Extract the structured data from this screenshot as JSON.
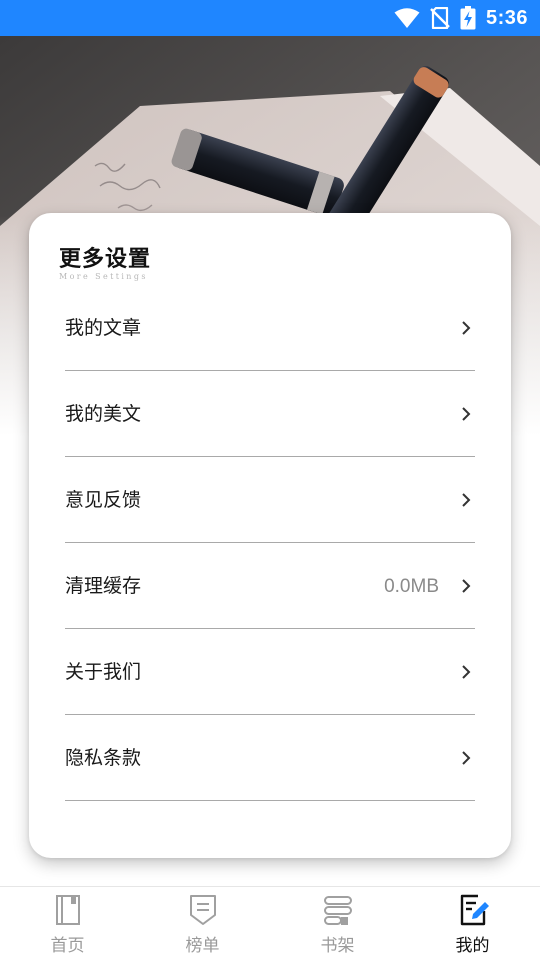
{
  "status_bar": {
    "time": "5:36",
    "icons": [
      "wifi-icon",
      "no-sim-icon",
      "battery-charging-icon"
    ],
    "background_color": "#1f86ff"
  },
  "hero": {
    "image": "pen-on-paper-photo"
  },
  "card": {
    "title": "更多设置",
    "subtitle": "More Settings",
    "items": [
      {
        "label": "我的文章",
        "value": "",
        "icon": "chevron-right-icon"
      },
      {
        "label": "我的美文",
        "value": "",
        "icon": "chevron-right-icon"
      },
      {
        "label": "意见反馈",
        "value": "",
        "icon": "chevron-right-icon"
      },
      {
        "label": "清理缓存",
        "value": "0.0MB",
        "icon": "chevron-right-icon"
      },
      {
        "label": "关于我们",
        "value": "",
        "icon": "chevron-right-icon"
      },
      {
        "label": "隐私条款",
        "value": "",
        "icon": "chevron-right-icon"
      }
    ]
  },
  "bottom_nav": {
    "items": [
      {
        "label": "首页",
        "icon": "book-icon",
        "active": false
      },
      {
        "label": "榜单",
        "icon": "ranking-badge-icon",
        "active": false
      },
      {
        "label": "书架",
        "icon": "bookshelf-icon",
        "active": false
      },
      {
        "label": "我的",
        "icon": "edit-document-icon",
        "active": true
      }
    ],
    "active_color": "#1f86ff",
    "inactive_color": "#9a9a9a"
  }
}
